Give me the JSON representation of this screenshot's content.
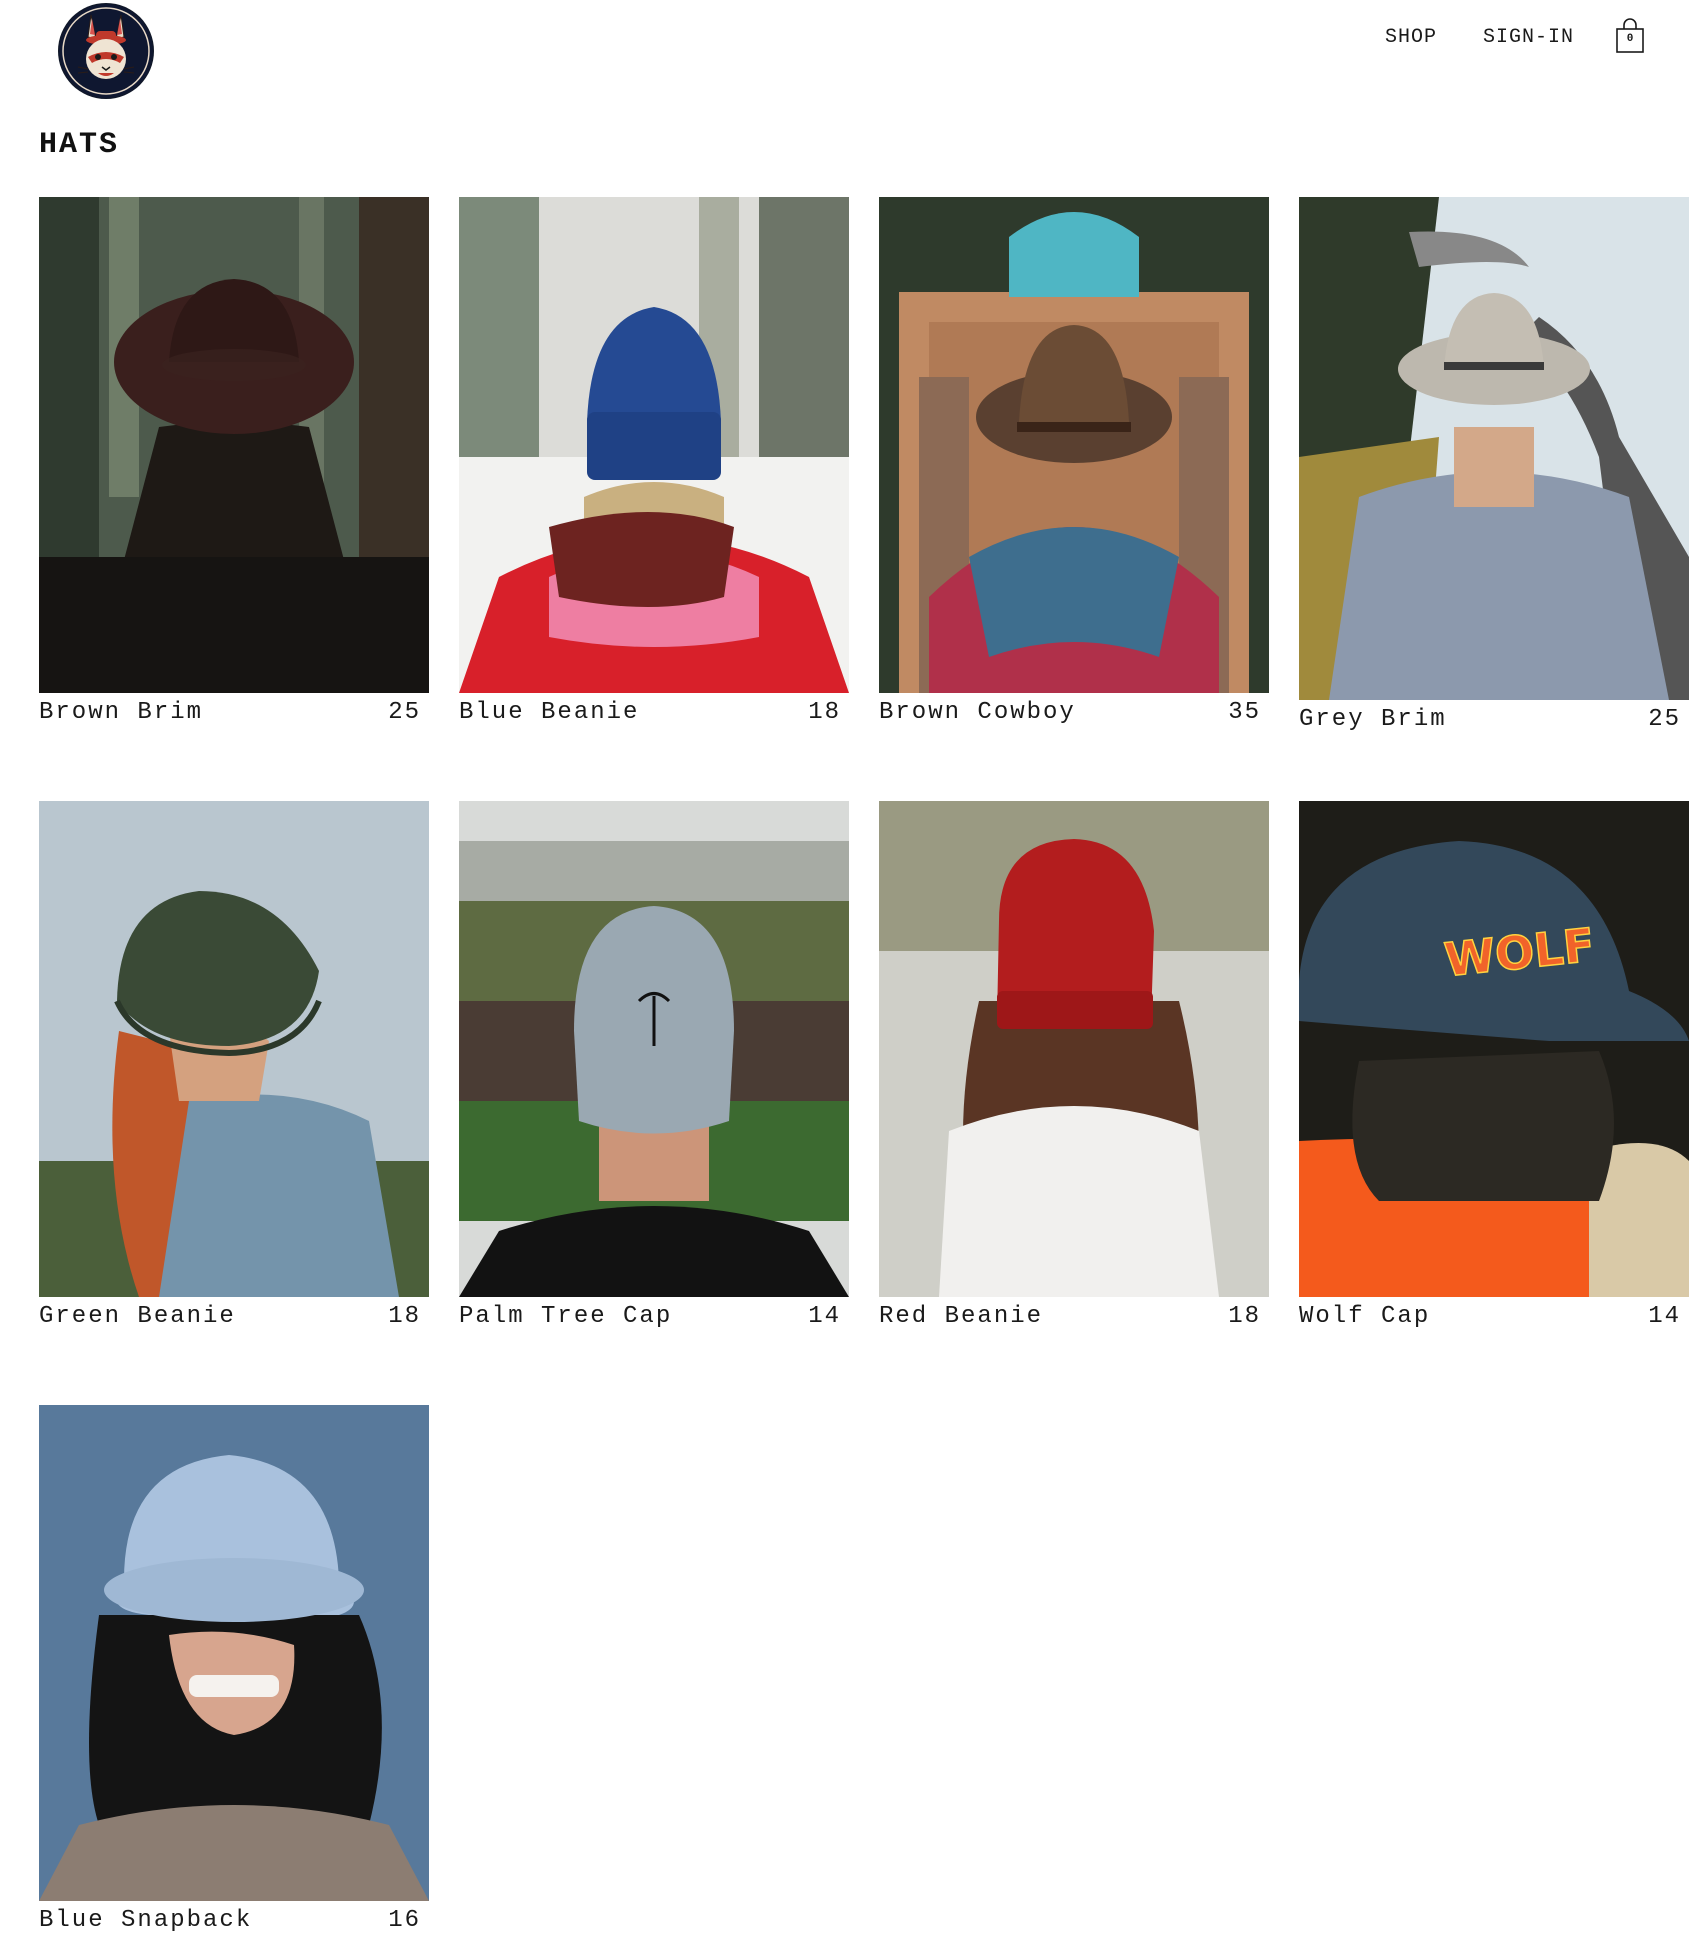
{
  "nav": {
    "shop_label": "SHOP",
    "signin_label": "SIGN-IN",
    "cart_count": "0"
  },
  "page": {
    "title": "HATS"
  },
  "products": [
    {
      "name": "Brown Brim",
      "price": "25"
    },
    {
      "name": "Blue Beanie",
      "price": "18"
    },
    {
      "name": "Brown Cowboy",
      "price": "35"
    },
    {
      "name": "Grey Brim",
      "price": "25"
    },
    {
      "name": "Green Beanie",
      "price": "18"
    },
    {
      "name": "Palm Tree Cap",
      "price": "14"
    },
    {
      "name": "Red Beanie",
      "price": "18"
    },
    {
      "name": "Wolf Cap",
      "price": "14"
    },
    {
      "name": "Blue Snapback",
      "price": "16"
    }
  ],
  "colors": {
    "text": "#1a1a1a",
    "logo_bg": "#111827",
    "logo_accent": "#c0392b"
  },
  "icons": {
    "logo": "rabbit-mascot-icon",
    "cart": "shopping-bag-icon"
  }
}
